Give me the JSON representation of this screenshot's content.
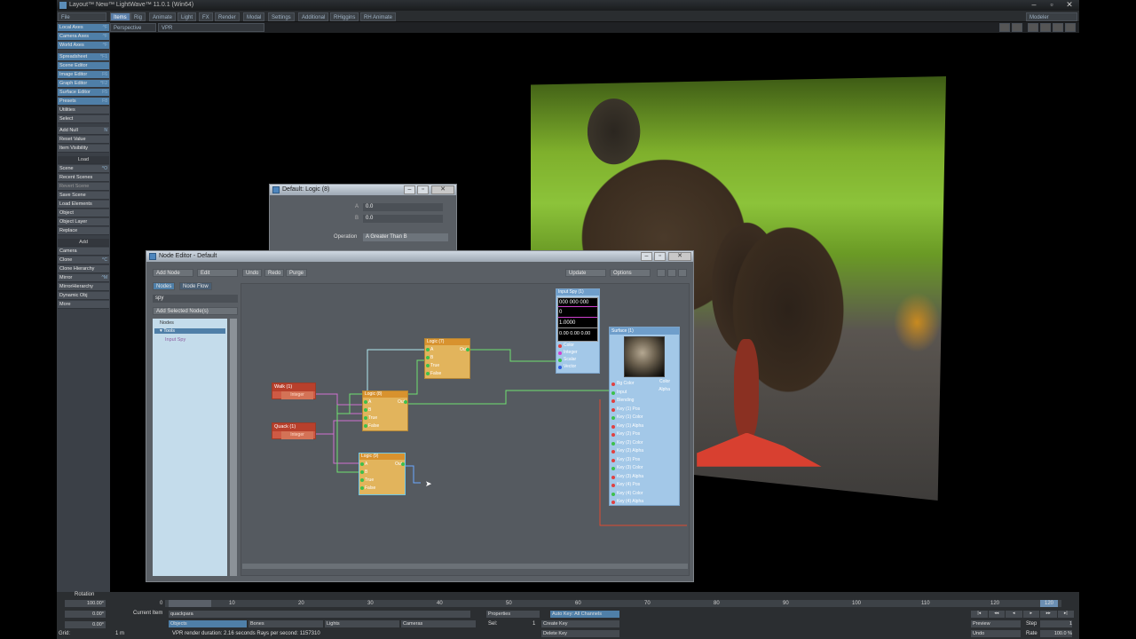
{
  "app": {
    "title": "Layout™ New™ LightWave™ 11.0.1 (Win64)",
    "workspace": "Modeler"
  },
  "menu": {
    "file": "File",
    "tabs": [
      "Items",
      "Rig",
      "Animate",
      "Light",
      "FX",
      "Render",
      "Modal",
      "Settings",
      "Additional",
      "RHiggins",
      "RH Animate"
    ]
  },
  "viewport": {
    "view_mode": "Perspective",
    "render_mode": "VPR"
  },
  "sidebar": {
    "group1": [
      {
        "label": "Local Axes",
        "sc": "^F"
      },
      {
        "label": "Camera Axes",
        "sc": "^F"
      },
      {
        "label": "World Axes",
        "sc": "^F"
      }
    ],
    "group2": [
      {
        "label": "Spreadsheet",
        "sc": "^F1"
      },
      {
        "label": "Scene Editor",
        "sc": ""
      },
      {
        "label": "Image Editor",
        "sc": "F6"
      },
      {
        "label": "Graph Editor",
        "sc": "^F2"
      },
      {
        "label": "Surface Editor",
        "sc": "F5"
      },
      {
        "label": "Presets",
        "sc": "F8"
      },
      {
        "label": "Utilities",
        "sc": ""
      },
      {
        "label": "Select",
        "sc": ""
      }
    ],
    "group3": [
      {
        "label": "Add Null",
        "sc": "N"
      },
      {
        "label": "Reset Value",
        "sc": ""
      },
      {
        "label": "Item Visibility",
        "sc": ""
      }
    ],
    "load_header": "Load",
    "group4": [
      {
        "label": "Scene",
        "sc": "^O"
      },
      {
        "label": "Recent Scenes",
        "sc": ""
      },
      {
        "label": "Revert Scene",
        "sc": ""
      },
      {
        "label": "Save Scene",
        "sc": ""
      },
      {
        "label": "Load Elements",
        "sc": ""
      },
      {
        "label": "Object",
        "sc": ""
      },
      {
        "label": "Object Layer",
        "sc": ""
      },
      {
        "label": "Replace",
        "sc": ""
      }
    ],
    "add_header": "Add",
    "group5": [
      {
        "label": "Camera",
        "sc": ""
      },
      {
        "label": "Clone",
        "sc": "^C"
      },
      {
        "label": "Clone Hierarchy",
        "sc": ""
      },
      {
        "label": "Mirror",
        "sc": "^M"
      },
      {
        "label": "MirrorHierarchy",
        "sc": ""
      },
      {
        "label": "Dynamic Obj",
        "sc": ""
      },
      {
        "label": "More",
        "sc": ""
      }
    ]
  },
  "logic_panel": {
    "title": "Default: Logic (8)",
    "a_label": "A",
    "a_value": "0.0",
    "b_label": "B",
    "b_value": "0.0",
    "op_label": "Operation",
    "op_value": "A Greater Than B"
  },
  "node_editor": {
    "title": "Node Editor - Default",
    "toolbar": {
      "add_node": "Add Node",
      "edit": "Edit",
      "undo": "Undo",
      "redo": "Redo",
      "purge": "Purge",
      "update": "Update",
      "options": "Options"
    },
    "tabs": {
      "nodes": "Nodes",
      "flow": "Node Flow"
    },
    "search": "spy",
    "add_selected": "Add Selected Node(s)",
    "tree": {
      "root": "Nodes",
      "folder": "Tools",
      "item": "Input Spy"
    }
  },
  "nodes": {
    "walk": {
      "title": "Walk (1)",
      "port": "Integer"
    },
    "quack": {
      "title": "Quack (1)",
      "port": "Integer"
    },
    "logic_top": {
      "title": "Logic (7)",
      "ports": [
        "A",
        "B",
        "True",
        "False"
      ],
      "out": "Out"
    },
    "logic_mid": {
      "title": "Logic (8)",
      "ports": [
        "A",
        "B",
        "True",
        "False"
      ],
      "out": "Out"
    },
    "logic_bot": {
      "title": "Logic (9)",
      "ports": [
        "A",
        "B",
        "True",
        "False"
      ],
      "out": "Out"
    },
    "spy": {
      "title": "Input Spy (1)",
      "color_readout": "000 000 000",
      "int_readout": "0",
      "scalar_readout": "1.0000",
      "vector_readout": "0.00 0.00 0.00",
      "ports": [
        "Color",
        "Integer",
        "Scalar",
        "Vector"
      ]
    },
    "surface": {
      "title": "Surface (1)",
      "out_color": "Color",
      "out_alpha": "Alpha",
      "ports": [
        "Bg Color",
        "Input",
        "Blending",
        "Key (1) Pos",
        "Key (1) Color",
        "Key (1) Alpha",
        "Key (2) Pos",
        "Key (2) Color",
        "Key (2) Alpha",
        "Key (3) Pos",
        "Key (3) Color",
        "Key (3) Alpha",
        "Key (4) Pos",
        "Key (4) Color",
        "Key (4) Alpha"
      ]
    }
  },
  "timeline": {
    "rotation_label": "Rotation",
    "rot_h": "100.00°",
    "rot_p": "0.00°",
    "rot_b": "0.00°",
    "grid_label": "Grid:",
    "grid_value": "1 m",
    "ticks": [
      "0",
      "10",
      "20",
      "30",
      "40",
      "50",
      "60",
      "70",
      "80",
      "90",
      "100",
      "110",
      "120"
    ],
    "current_frame": "120",
    "current_item_label": "Current Item",
    "current_item": "quackpara",
    "objects": "Objects",
    "bones": "Bones",
    "lights": "Lights",
    "cameras": "Cameras",
    "sel_label": "Sel:",
    "sel_value": "1",
    "vpr_status": "VPR render duration: 2.16 seconds  Rays per second: 1157310",
    "properties": "Properties",
    "auto_key": "Auto Key: All Channels",
    "create_key": "Create Key",
    "delete_key": "Delete Key",
    "preview": "Preview",
    "step_label": "Step",
    "step_value": "1",
    "rate_label": "Rate",
    "rate_value": "100.0 %",
    "undo_label": "Undo"
  },
  "colors": {
    "accent": "#4f7fa8",
    "node_orange": "#e2b45c",
    "node_red": "#cf5a44",
    "wire_green": "#3dc04c"
  }
}
